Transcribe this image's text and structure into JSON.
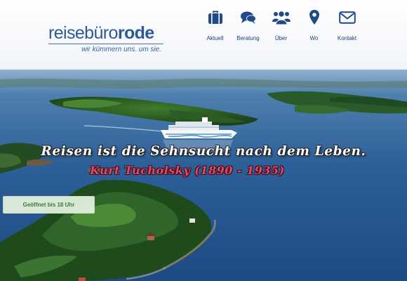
{
  "logo": {
    "wordmark_light": "reisebüro",
    "wordmark_bold": "rode",
    "tagline": "wir kümmern uns. um sie."
  },
  "nav": {
    "items": [
      {
        "label": "Aktuell",
        "icon": "briefcase-icon"
      },
      {
        "label": "Beratung",
        "icon": "chat-bubbles-icon"
      },
      {
        "label": "Über",
        "icon": "group-icon"
      },
      {
        "label": "Wo",
        "icon": "map-pin-icon"
      },
      {
        "label": "Kontakt",
        "icon": "envelope-icon"
      }
    ]
  },
  "hero": {
    "quote": "Reisen ist die Sehnsucht nach dem Leben.",
    "author": "Kurt Tucholsky (1890 - 1935)",
    "hours_badge": "Geöffnet bis 18 Uhr"
  },
  "colors": {
    "brand_blue": "#2e5a9c",
    "nav_icon_blue": "#1e4a8a",
    "author_pink": "#e04a68",
    "badge_green": "#3f7a3a"
  }
}
